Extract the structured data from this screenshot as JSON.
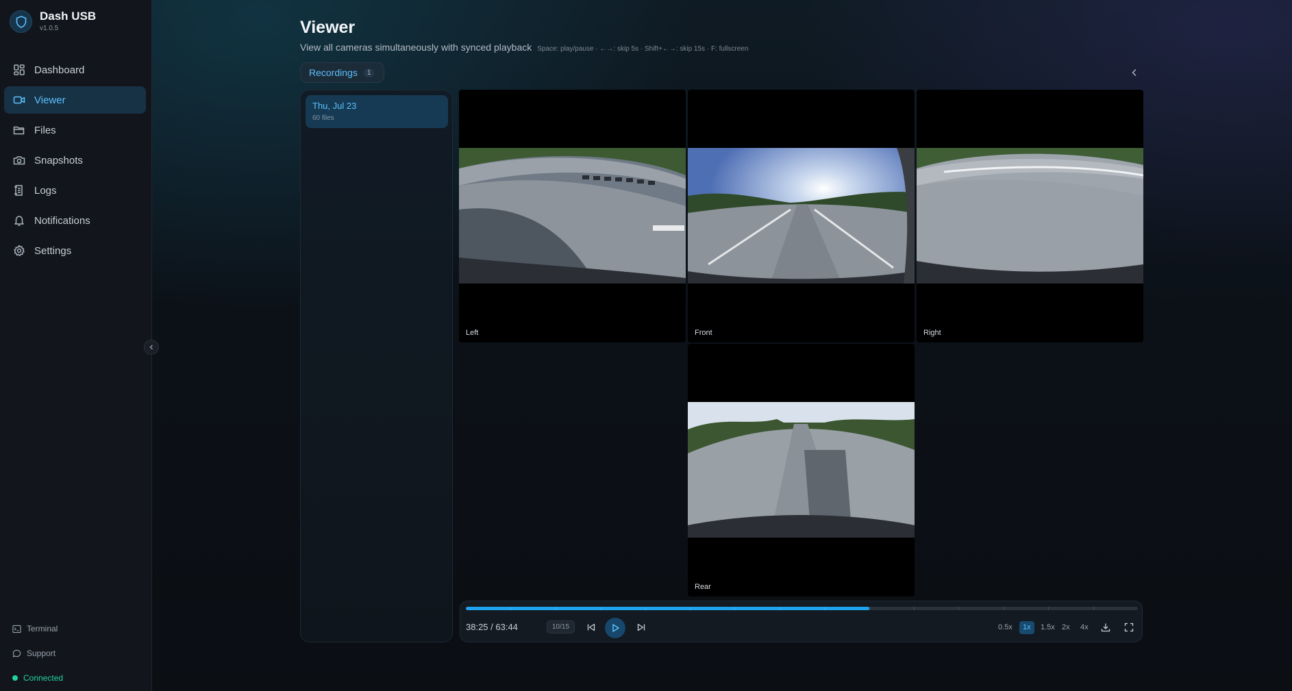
{
  "app": {
    "name": "Dash USB",
    "version": "v1.0.5"
  },
  "nav": {
    "items": [
      {
        "label": "Dashboard",
        "icon": "dashboard-icon"
      },
      {
        "label": "Viewer",
        "icon": "camera-icon",
        "active": true
      },
      {
        "label": "Files",
        "icon": "folder-icon"
      },
      {
        "label": "Snapshots",
        "icon": "snapshot-camera-icon"
      },
      {
        "label": "Logs",
        "icon": "logs-icon"
      },
      {
        "label": "Notifications",
        "icon": "bell-icon"
      },
      {
        "label": "Settings",
        "icon": "gear-icon"
      }
    ],
    "terminal": "Terminal",
    "support": "Support",
    "status": "Connected"
  },
  "header": {
    "title": "Viewer",
    "subtitle": "View all cameras simultaneously with synced playback",
    "shortcuts": "Space: play/pause · ←→: skip 5s · Shift+←→: skip 15s · F: fullscreen"
  },
  "recordings": {
    "tab_label": "Recordings",
    "count": "1",
    "items": [
      {
        "date": "Thu, Jul 23",
        "files": "60 files"
      }
    ]
  },
  "cameras": {
    "left": "Left",
    "front": "Front",
    "right": "Right",
    "rear": "Rear"
  },
  "player": {
    "time": "38:25 / 63:44",
    "clip": "10/15",
    "progress": 0.6,
    "speeds": [
      "0.5x",
      "1x",
      "1.5x",
      "2x",
      "4x"
    ],
    "active_speed": "1x"
  },
  "colors": {
    "accent": "#5cc0ff",
    "progress": "#1fa3ef",
    "status": "#22d3a0"
  }
}
